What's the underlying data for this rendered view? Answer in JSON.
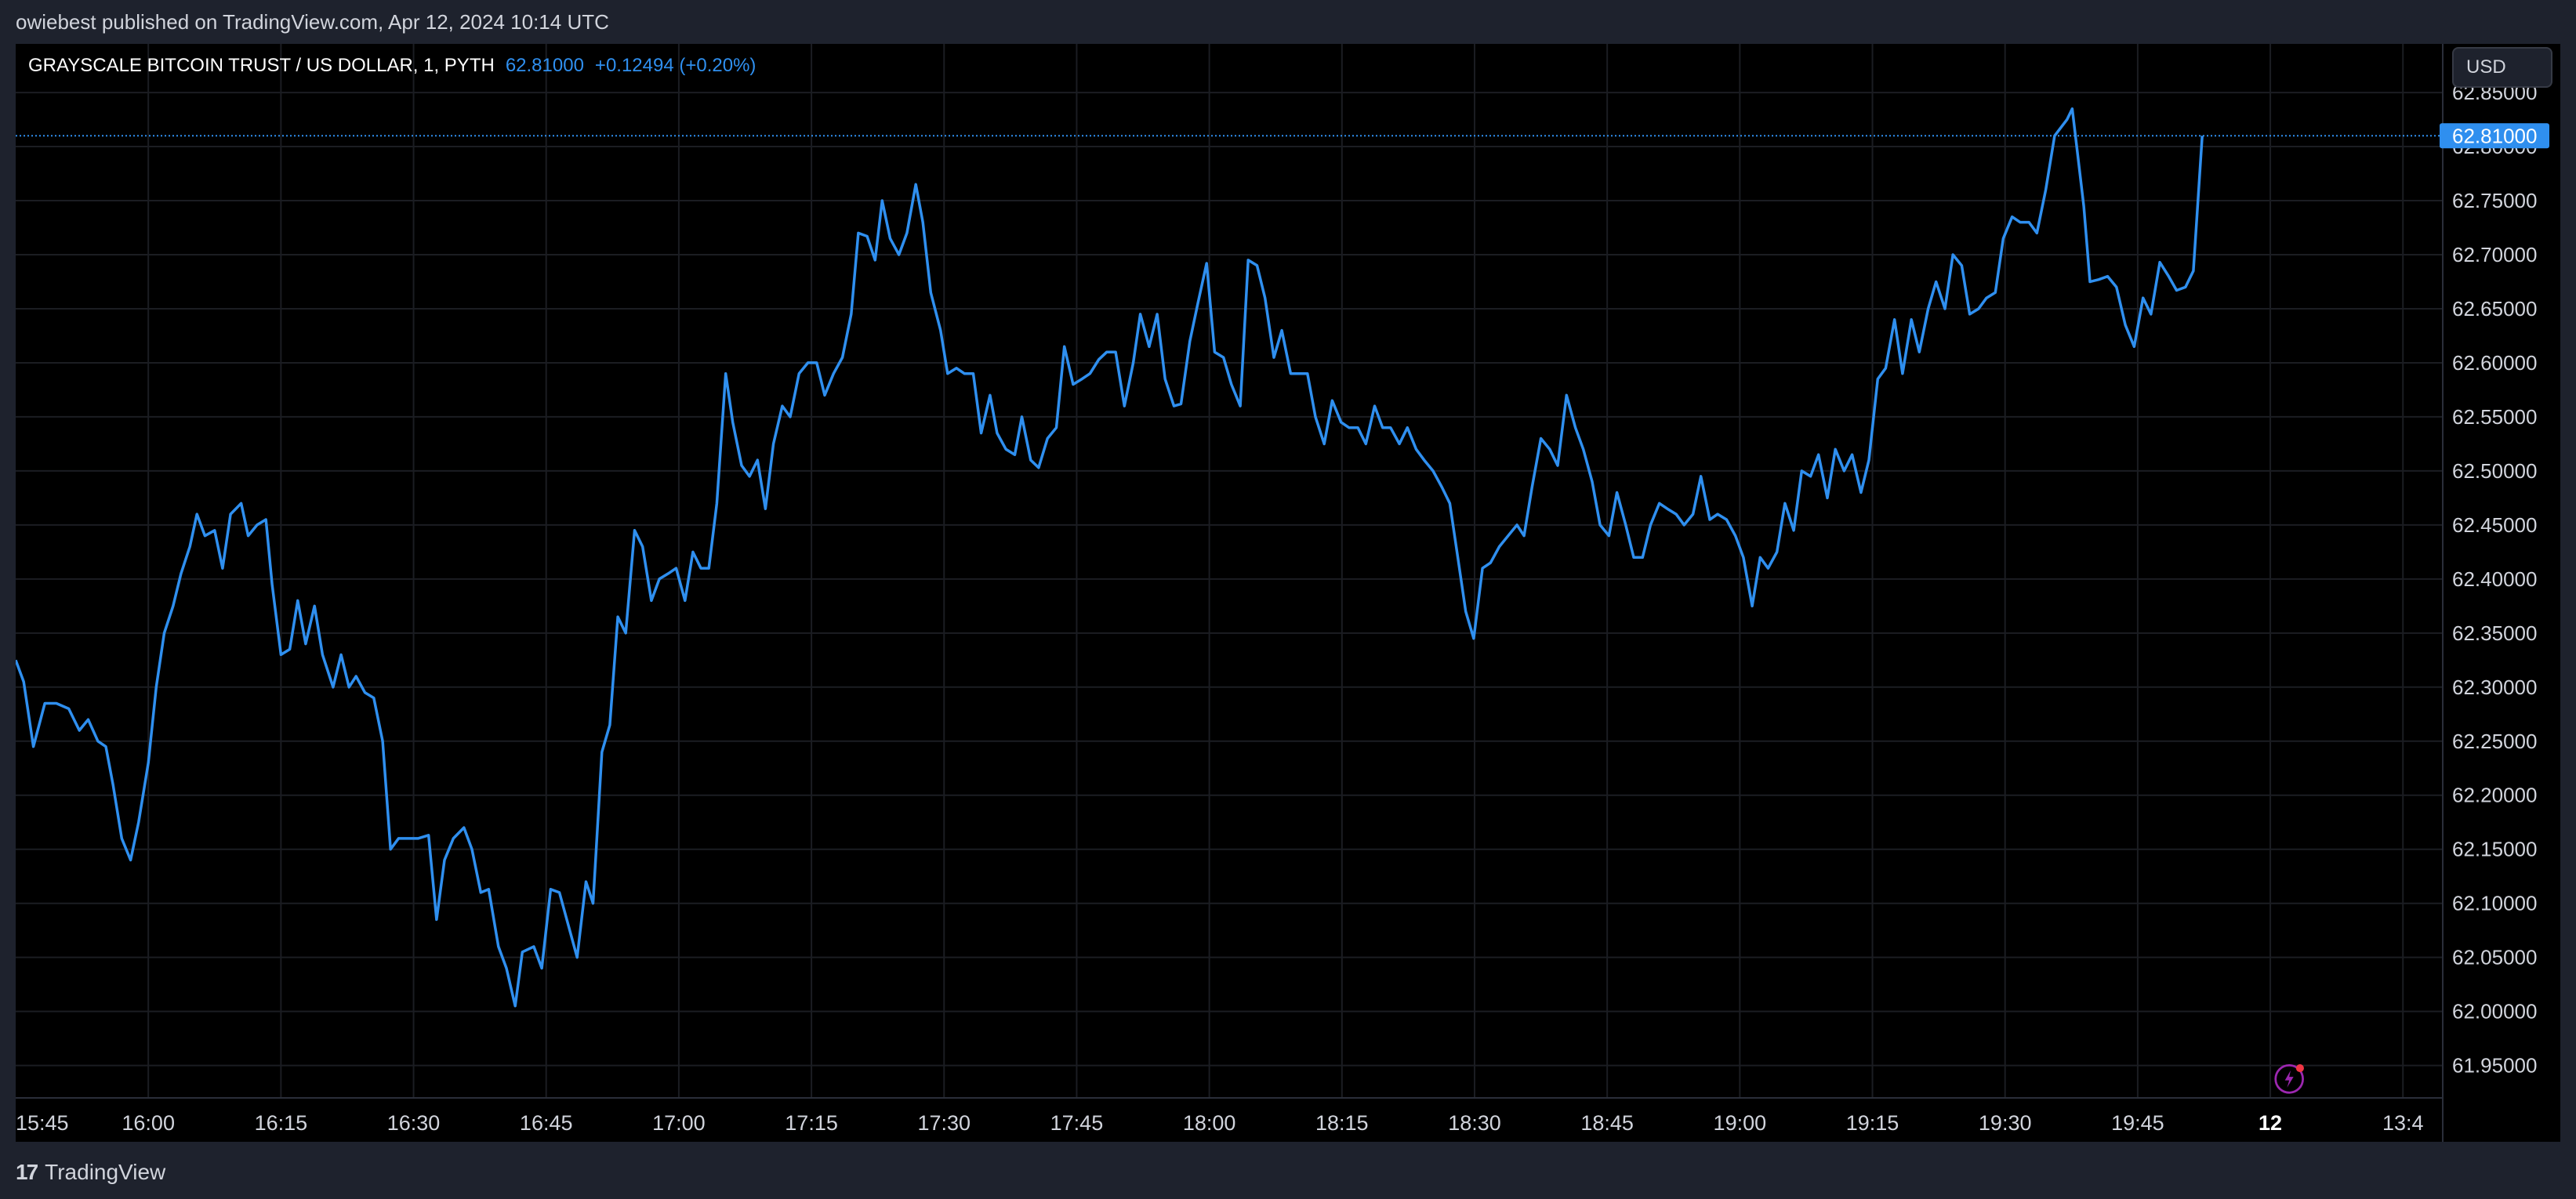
{
  "publish_note": "owiebest published on TradingView.com, Apr 12, 2024 10:14 UTC",
  "legend": {
    "symbol": "GRAYSCALE BITCOIN TRUST / US DOLLAR, 1, PYTH",
    "last": "62.81000",
    "change": "+0.12494 (+0.20%)"
  },
  "currency_button": "USD",
  "price_tag": "62.81000",
  "footer_brand": "TradingView",
  "colors": {
    "line": "#2f8fef",
    "background": "#000000",
    "frame": "#1e222d",
    "grid": "#1b1d22",
    "axis_text": "#d1d4dc"
  },
  "chart_data": {
    "type": "line",
    "title": "GRAYSCALE BITCOIN TRUST / US DOLLAR, 1, PYTH",
    "x_ticks": [
      {
        "t": 0,
        "label": "15:45"
      },
      {
        "t": 15,
        "label": "16:00"
      },
      {
        "t": 30,
        "label": "16:15"
      },
      {
        "t": 45,
        "label": "16:30"
      },
      {
        "t": 60,
        "label": "16:45"
      },
      {
        "t": 75,
        "label": "17:00"
      },
      {
        "t": 90,
        "label": "17:15"
      },
      {
        "t": 105,
        "label": "17:30"
      },
      {
        "t": 120,
        "label": "17:45"
      },
      {
        "t": 135,
        "label": "18:00"
      },
      {
        "t": 150,
        "label": "18:15"
      },
      {
        "t": 165,
        "label": "18:30"
      },
      {
        "t": 180,
        "label": "18:45"
      },
      {
        "t": 195,
        "label": "19:00"
      },
      {
        "t": 210,
        "label": "19:15"
      },
      {
        "t": 225,
        "label": "19:30"
      },
      {
        "t": 240,
        "label": "19:45"
      },
      {
        "t": 255,
        "label": "12",
        "bold": true
      },
      {
        "t": 270,
        "label": "13:4"
      }
    ],
    "y_ticks": [
      61.95,
      62.0,
      62.05,
      62.1,
      62.15,
      62.2,
      62.25,
      62.3,
      62.35,
      62.4,
      62.45,
      62.5,
      62.55,
      62.6,
      62.65,
      62.7,
      62.75,
      62.8,
      62.85
    ],
    "y_tick_labels": [
      "61.95000",
      "62.00000",
      "62.05000",
      "62.10000",
      "62.15000",
      "62.20000",
      "62.25000",
      "62.30000",
      "62.35000",
      "62.40000",
      "62.45000",
      "62.50000",
      "62.55000",
      "62.60000",
      "62.65000",
      "62.70000",
      "62.75000",
      "62.80000",
      "62.85000"
    ],
    "ylim": [
      61.92,
      62.895
    ],
    "xlim": [
      0,
      274.5
    ],
    "last_value": 62.81,
    "grid": true,
    "series": [
      {
        "points": [
          [
            0.0,
            62.325
          ],
          [
            0.9,
            62.305
          ],
          [
            2.0,
            62.245
          ],
          [
            3.3,
            62.285
          ],
          [
            4.6,
            62.285
          ],
          [
            6.0,
            62.28
          ],
          [
            7.2,
            62.26
          ],
          [
            8.2,
            62.27
          ],
          [
            9.3,
            62.25
          ],
          [
            10.2,
            62.245
          ],
          [
            11.0,
            62.21
          ],
          [
            12.0,
            62.16
          ],
          [
            13.0,
            62.14
          ],
          [
            13.9,
            62.175
          ],
          [
            15.0,
            62.23
          ],
          [
            15.9,
            62.3
          ],
          [
            16.8,
            62.35
          ],
          [
            17.8,
            62.375
          ],
          [
            18.7,
            62.405
          ],
          [
            19.7,
            62.43
          ],
          [
            20.5,
            62.46
          ],
          [
            21.4,
            62.44
          ],
          [
            22.5,
            62.445
          ],
          [
            23.4,
            62.41
          ],
          [
            24.3,
            62.46
          ],
          [
            25.5,
            62.47
          ],
          [
            26.3,
            62.44
          ],
          [
            27.3,
            62.45
          ],
          [
            28.3,
            62.455
          ],
          [
            29.0,
            62.395
          ],
          [
            30.0,
            62.33
          ],
          [
            31.0,
            62.335
          ],
          [
            31.9,
            62.38
          ],
          [
            32.8,
            62.34
          ],
          [
            33.8,
            62.375
          ],
          [
            34.7,
            62.33
          ],
          [
            35.9,
            62.3
          ],
          [
            36.8,
            62.33
          ],
          [
            37.7,
            62.3
          ],
          [
            38.5,
            62.31
          ],
          [
            39.5,
            62.295
          ],
          [
            40.5,
            62.29
          ],
          [
            41.5,
            62.25
          ],
          [
            42.4,
            62.15
          ],
          [
            43.3,
            62.16
          ],
          [
            44.4,
            62.16
          ],
          [
            45.5,
            62.16
          ],
          [
            46.7,
            62.163
          ],
          [
            47.6,
            62.085
          ],
          [
            48.5,
            62.14
          ],
          [
            49.5,
            62.16
          ],
          [
            50.7,
            62.17
          ],
          [
            51.6,
            62.15
          ],
          [
            52.6,
            62.11
          ],
          [
            53.5,
            62.113
          ],
          [
            54.6,
            62.06
          ],
          [
            55.5,
            62.04
          ],
          [
            56.5,
            62.005
          ],
          [
            57.3,
            62.055
          ],
          [
            58.6,
            62.06
          ],
          [
            59.5,
            62.04
          ],
          [
            60.5,
            62.113
          ],
          [
            61.5,
            62.11
          ],
          [
            62.5,
            62.08
          ],
          [
            63.5,
            62.05
          ],
          [
            64.5,
            62.12
          ],
          [
            65.3,
            62.1
          ],
          [
            66.3,
            62.24
          ],
          [
            67.2,
            62.265
          ],
          [
            68.1,
            62.365
          ],
          [
            69.0,
            62.35
          ],
          [
            70.0,
            62.445
          ],
          [
            70.9,
            62.43
          ],
          [
            71.9,
            62.38
          ],
          [
            72.8,
            62.4
          ],
          [
            73.8,
            62.405
          ],
          [
            74.7,
            62.41
          ],
          [
            75.7,
            62.38
          ],
          [
            76.6,
            62.425
          ],
          [
            77.5,
            62.41
          ],
          [
            78.4,
            62.41
          ],
          [
            79.3,
            62.47
          ],
          [
            80.3,
            62.59
          ],
          [
            81.1,
            62.545
          ],
          [
            82.1,
            62.505
          ],
          [
            83.0,
            62.495
          ],
          [
            83.9,
            62.51
          ],
          [
            84.8,
            62.465
          ],
          [
            85.7,
            62.525
          ],
          [
            86.7,
            62.56
          ],
          [
            87.6,
            62.55
          ],
          [
            88.6,
            62.59
          ],
          [
            89.6,
            62.6
          ],
          [
            90.6,
            62.6
          ],
          [
            91.5,
            62.57
          ],
          [
            92.5,
            62.59
          ],
          [
            93.5,
            62.605
          ],
          [
            94.5,
            62.645
          ],
          [
            95.3,
            62.72
          ],
          [
            96.3,
            62.717
          ],
          [
            97.2,
            62.695
          ],
          [
            98.0,
            62.75
          ],
          [
            98.9,
            62.715
          ],
          [
            99.9,
            62.7
          ],
          [
            100.8,
            62.72
          ],
          [
            101.8,
            62.765
          ],
          [
            102.6,
            62.73
          ],
          [
            103.5,
            62.665
          ],
          [
            104.6,
            62.63
          ],
          [
            105.4,
            62.59
          ],
          [
            106.4,
            62.595
          ],
          [
            107.3,
            62.59
          ],
          [
            108.3,
            62.59
          ],
          [
            109.2,
            62.535
          ],
          [
            110.2,
            62.57
          ],
          [
            111.0,
            62.535
          ],
          [
            112.0,
            62.52
          ],
          [
            113.0,
            62.515
          ],
          [
            113.8,
            62.55
          ],
          [
            114.8,
            62.51
          ],
          [
            115.7,
            62.503
          ],
          [
            116.7,
            62.53
          ],
          [
            117.7,
            62.54
          ],
          [
            118.6,
            62.615
          ],
          [
            119.6,
            62.58
          ],
          [
            120.6,
            62.585
          ],
          [
            121.5,
            62.59
          ],
          [
            122.5,
            62.603
          ],
          [
            123.4,
            62.61
          ],
          [
            124.4,
            62.61
          ],
          [
            125.4,
            62.56
          ],
          [
            126.4,
            62.6
          ],
          [
            127.2,
            62.645
          ],
          [
            128.2,
            62.615
          ],
          [
            129.1,
            62.645
          ],
          [
            130.0,
            62.585
          ],
          [
            131.0,
            62.56
          ],
          [
            131.8,
            62.562
          ],
          [
            132.8,
            62.62
          ],
          [
            133.7,
            62.655
          ],
          [
            134.7,
            62.692
          ],
          [
            135.6,
            62.61
          ],
          [
            136.6,
            62.605
          ],
          [
            137.5,
            62.58
          ],
          [
            138.5,
            62.56
          ],
          [
            139.4,
            62.695
          ],
          [
            140.4,
            62.69
          ],
          [
            141.3,
            62.66
          ],
          [
            142.3,
            62.605
          ],
          [
            143.2,
            62.63
          ],
          [
            144.2,
            62.59
          ],
          [
            145.2,
            62.59
          ],
          [
            146.1,
            62.59
          ],
          [
            147.0,
            62.55
          ],
          [
            148.0,
            62.525
          ],
          [
            148.9,
            62.565
          ],
          [
            149.9,
            62.545
          ],
          [
            150.8,
            62.54
          ],
          [
            151.8,
            62.54
          ],
          [
            152.7,
            62.525
          ],
          [
            153.7,
            62.56
          ],
          [
            154.6,
            62.54
          ],
          [
            155.5,
            62.54
          ],
          [
            156.5,
            62.525
          ],
          [
            157.4,
            62.54
          ],
          [
            158.4,
            62.52
          ],
          [
            159.3,
            62.51
          ],
          [
            160.3,
            62.5
          ],
          [
            161.3,
            62.485
          ],
          [
            162.2,
            62.47
          ],
          [
            163.1,
            62.42
          ],
          [
            164.0,
            62.37
          ],
          [
            164.9,
            62.345
          ],
          [
            165.9,
            62.41
          ],
          [
            166.8,
            62.415
          ],
          [
            167.8,
            62.43
          ],
          [
            168.8,
            62.44
          ],
          [
            169.8,
            62.45
          ],
          [
            170.6,
            62.44
          ],
          [
            171.5,
            62.485
          ],
          [
            172.5,
            62.53
          ],
          [
            173.5,
            62.52
          ],
          [
            174.4,
            62.505
          ],
          [
            175.4,
            62.57
          ],
          [
            176.4,
            62.54
          ],
          [
            177.3,
            62.52
          ],
          [
            178.3,
            62.49
          ],
          [
            179.2,
            62.45
          ],
          [
            180.2,
            62.44
          ],
          [
            181.1,
            62.48
          ],
          [
            182.1,
            62.45
          ],
          [
            183.0,
            62.42
          ],
          [
            184.0,
            62.42
          ],
          [
            184.9,
            62.45
          ],
          [
            185.9,
            62.47
          ],
          [
            186.8,
            62.465
          ],
          [
            187.8,
            62.46
          ],
          [
            188.7,
            62.45
          ],
          [
            189.7,
            62.46
          ],
          [
            190.6,
            62.495
          ],
          [
            191.6,
            62.455
          ],
          [
            192.5,
            62.46
          ],
          [
            193.5,
            62.455
          ],
          [
            194.5,
            62.44
          ],
          [
            195.4,
            62.42
          ],
          [
            196.4,
            62.375
          ],
          [
            197.3,
            62.42
          ],
          [
            198.2,
            62.41
          ],
          [
            199.2,
            62.425
          ],
          [
            200.1,
            62.47
          ],
          [
            201.1,
            62.445
          ],
          [
            202.0,
            62.5
          ],
          [
            203.0,
            62.495
          ],
          [
            203.9,
            62.515
          ],
          [
            204.9,
            62.475
          ],
          [
            205.8,
            62.52
          ],
          [
            206.8,
            62.5
          ],
          [
            207.7,
            62.515
          ],
          [
            208.7,
            62.48
          ],
          [
            209.6,
            62.51
          ],
          [
            210.6,
            62.585
          ],
          [
            211.5,
            62.595
          ],
          [
            212.5,
            62.64
          ],
          [
            213.4,
            62.59
          ],
          [
            214.4,
            62.64
          ],
          [
            215.3,
            62.61
          ],
          [
            216.3,
            62.65
          ],
          [
            217.2,
            62.675
          ],
          [
            218.2,
            62.65
          ],
          [
            219.1,
            62.7
          ],
          [
            220.1,
            62.69
          ],
          [
            221.0,
            62.645
          ],
          [
            222.0,
            62.65
          ],
          [
            222.9,
            62.66
          ],
          [
            223.9,
            62.665
          ],
          [
            224.8,
            62.715
          ],
          [
            225.8,
            62.735
          ],
          [
            226.7,
            62.73
          ],
          [
            227.7,
            62.73
          ],
          [
            228.6,
            62.72
          ],
          [
            229.6,
            62.76
          ],
          [
            230.6,
            62.81
          ],
          [
            232.0,
            62.825
          ],
          [
            232.6,
            62.835
          ],
          [
            233.9,
            62.745
          ],
          [
            234.6,
            62.675
          ],
          [
            235.6,
            62.677
          ],
          [
            236.6,
            62.68
          ],
          [
            237.6,
            62.67
          ],
          [
            238.6,
            62.635
          ],
          [
            239.6,
            62.615
          ],
          [
            240.6,
            62.66
          ],
          [
            241.5,
            62.645
          ],
          [
            242.5,
            62.693
          ],
          [
            243.5,
            62.68
          ],
          [
            244.4,
            62.667
          ],
          [
            245.4,
            62.67
          ],
          [
            246.3,
            62.685
          ],
          [
            247.3,
            62.81
          ]
        ]
      }
    ]
  }
}
